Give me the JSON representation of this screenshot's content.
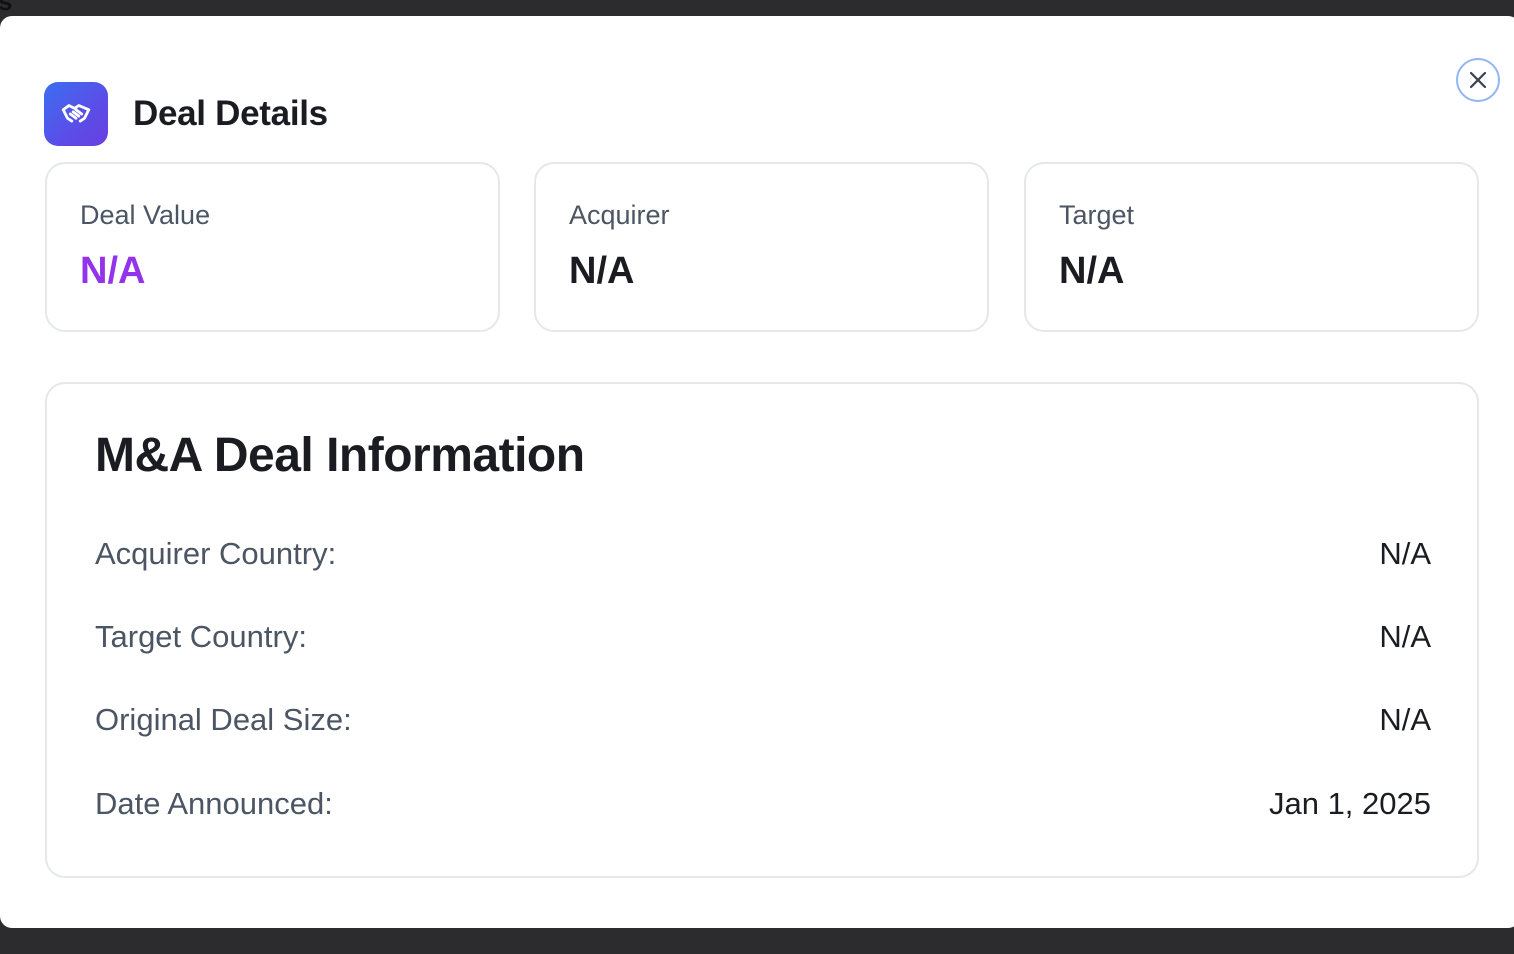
{
  "backdrop": {
    "glyph": "s"
  },
  "dialog": {
    "title": "Deal Details",
    "icon": "handshake-icon",
    "close_icon": "close-icon",
    "accent_color": "#9333ea",
    "icon_gradient": [
      "#3b6ff0",
      "#6a3fe0"
    ]
  },
  "summary_cards": [
    {
      "label": "Deal Value",
      "value": "N/A"
    },
    {
      "label": "Acquirer",
      "value": "N/A"
    },
    {
      "label": "Target",
      "value": "N/A"
    }
  ],
  "info": {
    "title": "M&A Deal Information",
    "rows": [
      {
        "label": "Acquirer Country:",
        "value": "N/A"
      },
      {
        "label": "Target Country:",
        "value": "N/A"
      },
      {
        "label": "Original Deal Size:",
        "value": "N/A"
      },
      {
        "label": "Date Announced:",
        "value": "Jan 1, 2025"
      }
    ]
  }
}
